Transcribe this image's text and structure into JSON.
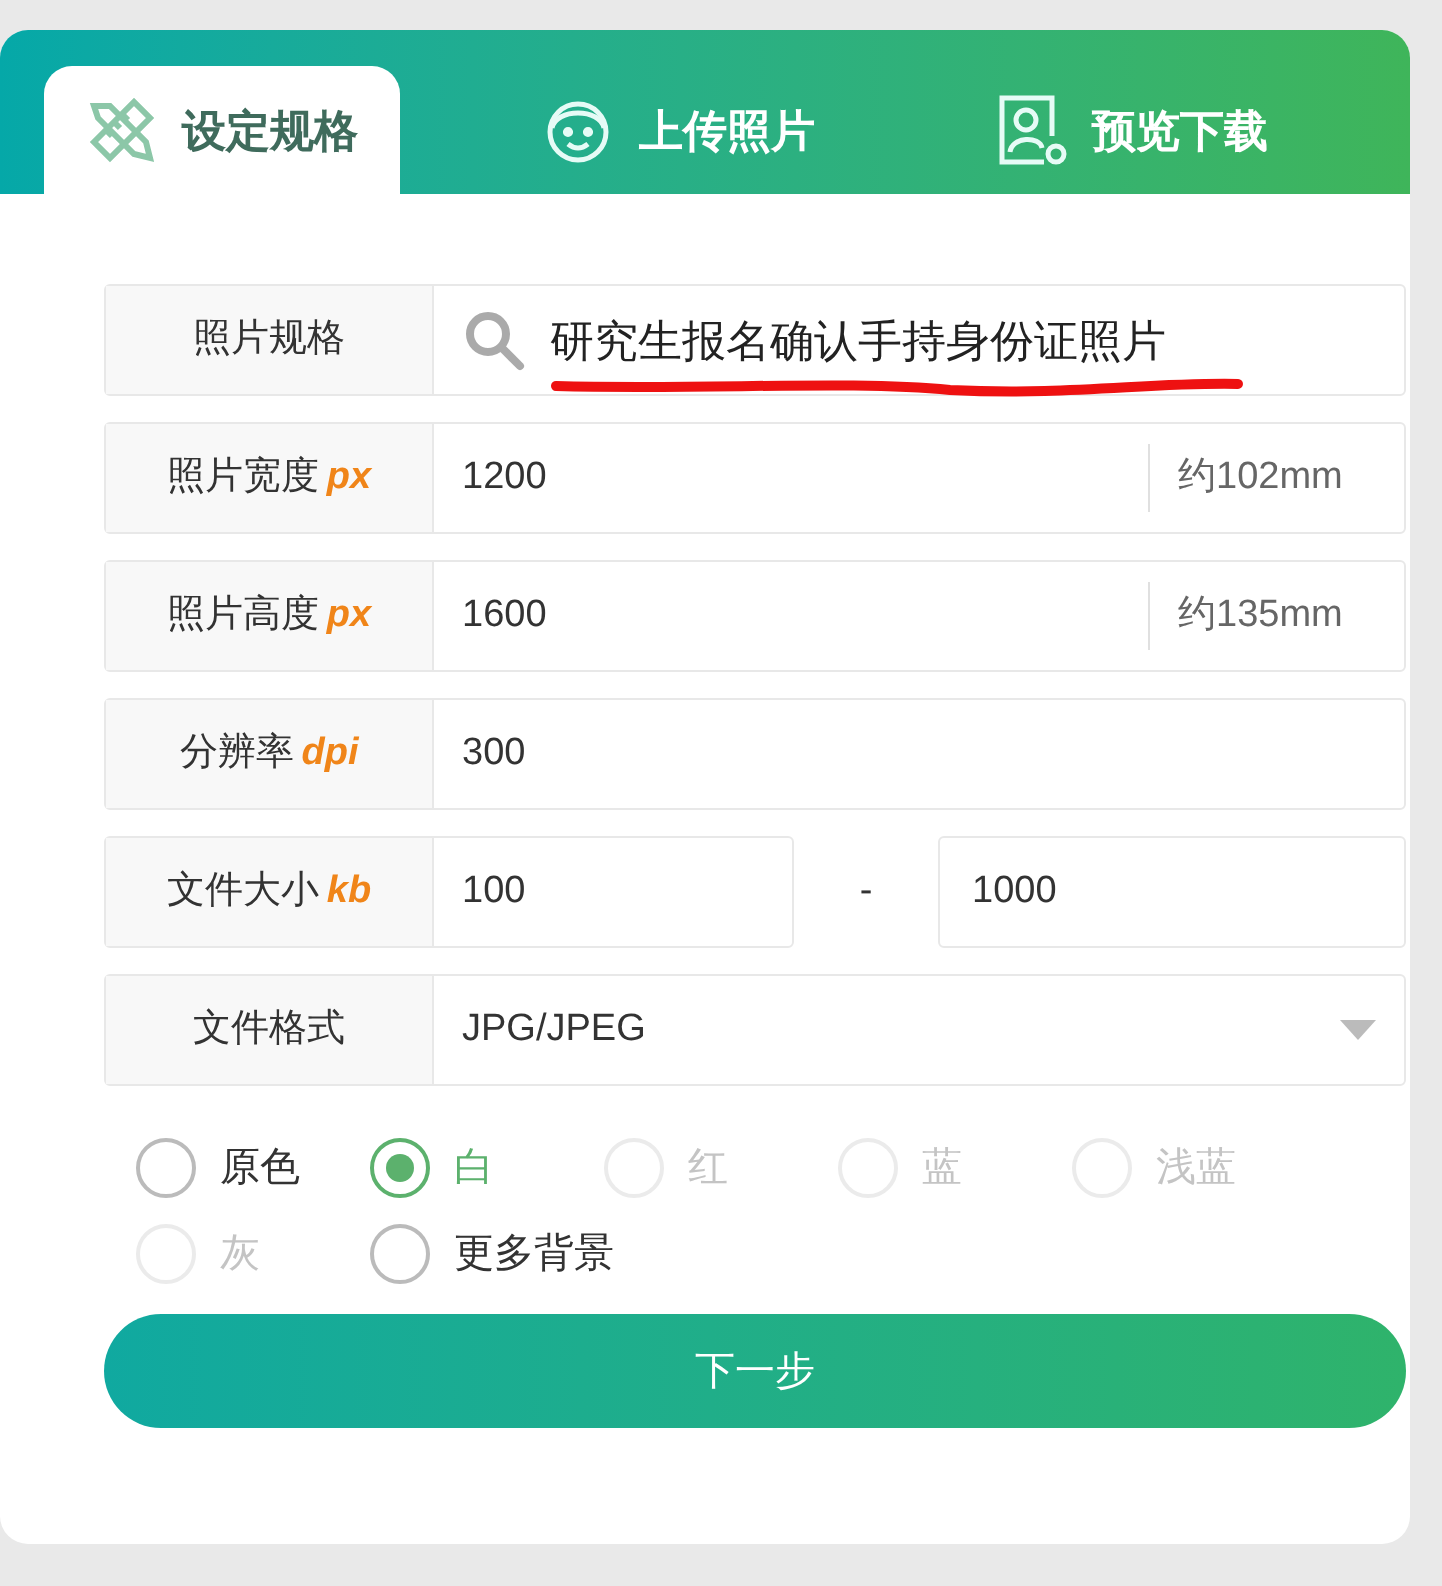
{
  "tabs": [
    {
      "label": "设定规格",
      "kind": "ruler",
      "selected": true
    },
    {
      "label": "上传照片",
      "kind": "face",
      "selected": false
    },
    {
      "label": "预览下载",
      "kind": "portrait",
      "selected": false
    }
  ],
  "fields": [
    {
      "kind": "search",
      "label": "照片规格",
      "value": "研究生报名确认手持身份证照片",
      "marked": true
    },
    {
      "kind": "text",
      "label": "照片宽度",
      "unit": "px",
      "value": "1200",
      "note": "约102mm"
    },
    {
      "kind": "text",
      "label": "照片高度",
      "unit": "px",
      "value": "1600",
      "note": "约135mm"
    },
    {
      "kind": "text",
      "label": "分辨率",
      "unit": "dpi",
      "value": "300"
    },
    {
      "kind": "range",
      "label": "文件大小",
      "unit": "kb",
      "value": "100",
      "separator": "-",
      "value_max": "1000"
    },
    {
      "kind": "select",
      "label": "文件格式",
      "value": "JPG/JPEG"
    }
  ],
  "backgrounds": [
    {
      "label": "原色",
      "selected": false,
      "disabled": false
    },
    {
      "label": "白",
      "selected": true,
      "disabled": false
    },
    {
      "label": "红",
      "selected": false,
      "disabled": true
    },
    {
      "label": "蓝",
      "selected": false,
      "disabled": true
    },
    {
      "label": "浅蓝",
      "selected": false,
      "disabled": true
    },
    {
      "label": "灰",
      "selected": false,
      "disabled": true
    },
    {
      "label": "更多背景",
      "selected": false,
      "disabled": false
    }
  ],
  "next_button": "下一步"
}
